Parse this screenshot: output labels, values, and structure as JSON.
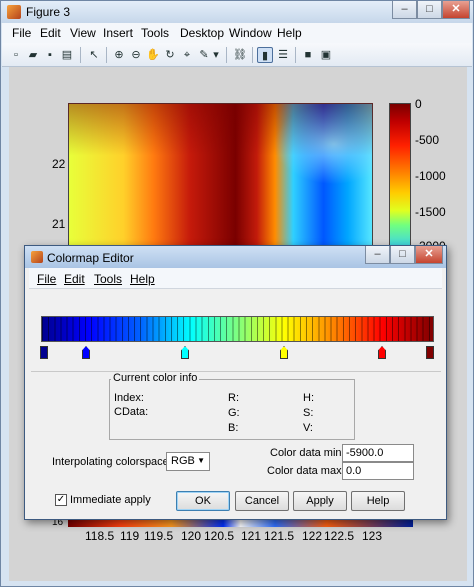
{
  "figure_window": {
    "title": "Figure 3",
    "controls": {
      "minimize": "–",
      "maximize": "□",
      "close": "✕"
    },
    "menu": [
      "File",
      "Edit",
      "View",
      "Insert",
      "Tools",
      "Desktop",
      "Window",
      "Help"
    ],
    "toolbar_icons": [
      "new-figure-icon",
      "open-icon",
      "save-icon",
      "print-icon",
      "pointer-icon",
      "zoom-in-icon",
      "zoom-out-icon",
      "pan-icon",
      "rotate-icon",
      "data-cursor-icon",
      "brush-icon",
      "brush-dropdown-icon",
      "link-icon",
      "colorbar-icon",
      "legend-icon",
      "hide-plot-tools-icon",
      "show-plot-tools-icon"
    ],
    "plot": {
      "y_ticks": [
        "22",
        "21"
      ],
      "x_ticks": [
        "118.5",
        "119",
        "119.5",
        "120",
        "120.5",
        "121",
        "121.5",
        "122",
        "122.5",
        "123"
      ],
      "colorbar_ticks": [
        "0",
        "-500",
        "-1000",
        "-1500",
        "-2000"
      ],
      "partial_bottom_label": "16"
    }
  },
  "colormap_editor": {
    "title": "Colormap Editor",
    "controls": {
      "minimize": "–",
      "maximize": "□",
      "close": "✕"
    },
    "menu": [
      "File",
      "Edit",
      "Tools",
      "Help"
    ],
    "markers": [
      {
        "color": "#00008f"
      },
      {
        "color": "#0000ff"
      },
      {
        "color": "#00ffff"
      },
      {
        "color": "#ffff00"
      },
      {
        "color": "#ff0000"
      },
      {
        "color": "#800000"
      }
    ],
    "current_color_info": {
      "legend": "Current color info",
      "index_label": "Index:",
      "cdata_label": "CData:",
      "r_label": "R:",
      "g_label": "G:",
      "b_label": "B:",
      "h_label": "H:",
      "s_label": "S:",
      "v_label": "V:"
    },
    "interpolating_label": "Interpolating colorspace:",
    "interpolating_value": "RGB",
    "color_min_label": "Color data min:",
    "color_min_value": "-5900.0",
    "color_max_label": "Color data max:",
    "color_max_value": "0.0",
    "immediate_apply_label": "Immediate apply",
    "immediate_apply_checked": true,
    "buttons": {
      "ok": "OK",
      "cancel": "Cancel",
      "apply": "Apply",
      "help": "Help"
    }
  }
}
